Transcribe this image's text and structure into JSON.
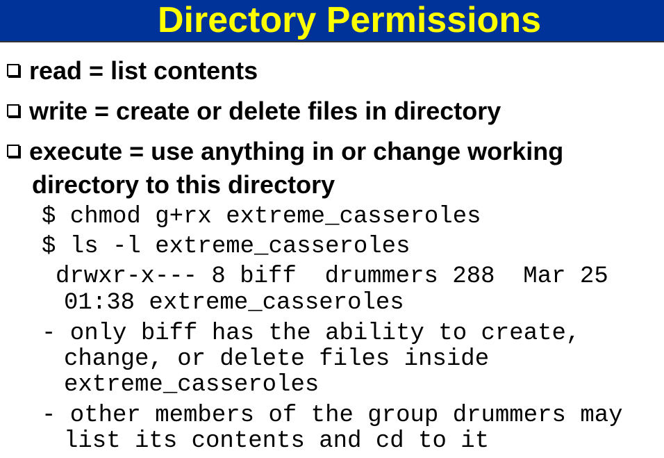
{
  "title": "Directory Permissions",
  "bullets": [
    "read = list contents",
    "write = create or delete files in directory",
    "execute = use anything in or change working",
    "directory to this directory"
  ],
  "code": [
    "$ chmod g+rx extreme_casseroles",
    "$ ls -l extreme_casseroles",
    "drwxr-x--- 8 biff  drummers 288  Mar 25",
    "01:38 extreme_casseroles",
    "- only biff has the ability to create,",
    "change, or delete files inside",
    "extreme_casseroles",
    "- other members of the group drummers may",
    "list its contents and cd to it"
  ]
}
